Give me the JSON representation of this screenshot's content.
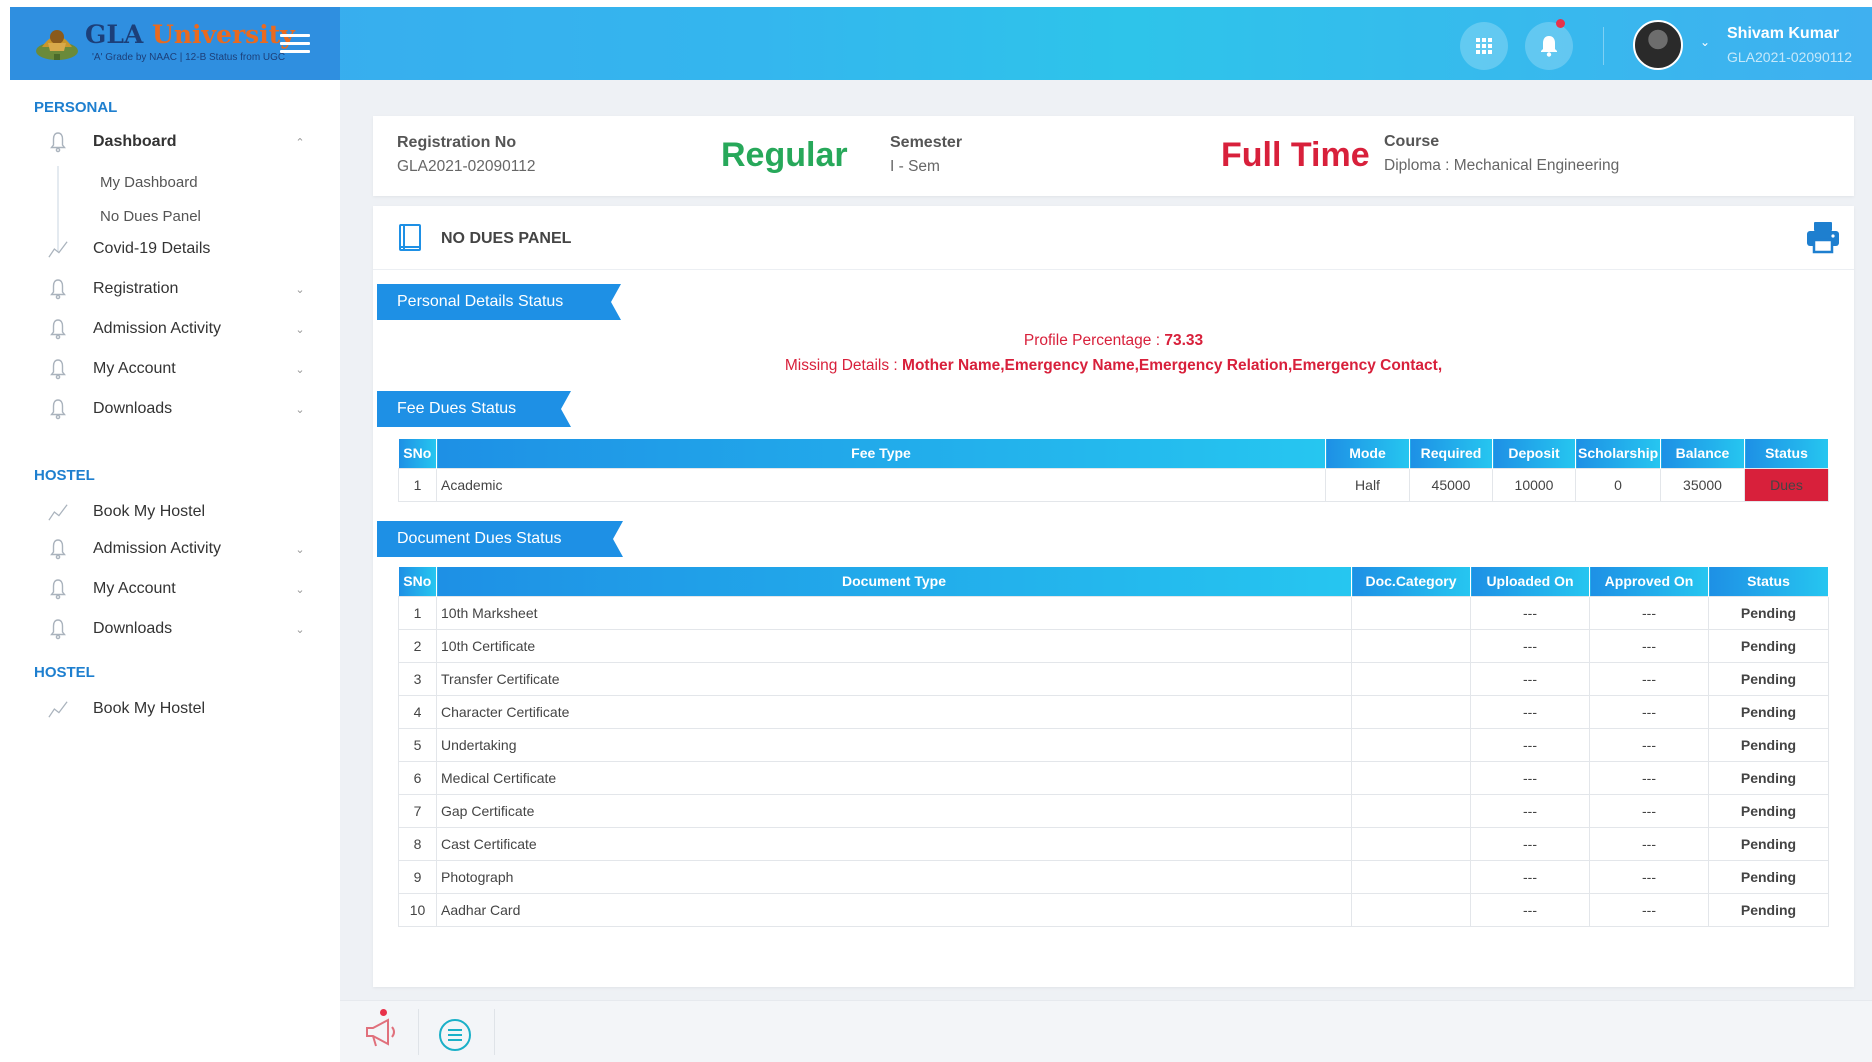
{
  "header": {
    "logo": {
      "name_part1": "GLA",
      "name_part2": "University",
      "tagline": "'A' Grade by NAAC | 12-B Status from UGC"
    },
    "user": {
      "name": "Shivam Kumar",
      "id": "GLA2021-02090112"
    }
  },
  "sidebar": {
    "sections": [
      {
        "title": "PERSONAL"
      },
      {
        "title": "HOSTEL"
      },
      {
        "title": "HOSTEL"
      }
    ],
    "items": [
      {
        "label": "Dashboard",
        "icon": "bell-icon"
      },
      {
        "label": "Covid-19 Details",
        "icon": "chart-line-icon"
      },
      {
        "label": "Registration",
        "icon": "bell-icon"
      },
      {
        "label": "Admission Activity",
        "icon": "bell-icon"
      },
      {
        "label": "My Account",
        "icon": "bell-icon"
      },
      {
        "label": "Downloads",
        "icon": "bell-icon"
      },
      {
        "label": "Book My Hostel",
        "icon": "chart-line-icon"
      },
      {
        "label": "Admission Activity",
        "icon": "bell-icon"
      },
      {
        "label": "My Account",
        "icon": "bell-icon"
      },
      {
        "label": "Downloads",
        "icon": "bell-icon"
      },
      {
        "label": "Book My Hostel",
        "icon": "chart-line-icon"
      }
    ],
    "dashboard_sub": [
      "My Dashboard",
      "No Dues Panel"
    ]
  },
  "info": {
    "reg_label": "Registration No",
    "reg_value": "GLA2021-02090112",
    "type": "Regular",
    "semester_label": "Semester",
    "semester_value": "I - Sem",
    "mode": "Full Time",
    "course_label": "Course",
    "course_value": "Diploma : Mechanical Engineering"
  },
  "panel": {
    "title": "NO DUES PANEL",
    "personal_section": "Personal Details Status",
    "profile_label": "Profile Percentage : ",
    "profile_value": "73.33",
    "missing_label": "Missing Details : ",
    "missing_value": "Mother Name,Emergency Name,Emergency Relation,Emergency Contact,",
    "fee_section": "Fee Dues Status",
    "doc_section": "Document Dues Status"
  },
  "fee_table": {
    "headers": [
      "SNo",
      "Fee Type",
      "Mode",
      "Required",
      "Deposit",
      "Scholarship",
      "Balance",
      "Status"
    ],
    "rows": [
      {
        "sno": "1",
        "type": "Academic",
        "mode": "Half",
        "required": "45000",
        "deposit": "10000",
        "scholarship": "0",
        "balance": "35000",
        "status": "Dues"
      }
    ]
  },
  "doc_table": {
    "headers": [
      "SNo",
      "Document Type",
      "Doc.Category",
      "Uploaded On",
      "Approved On",
      "Status"
    ],
    "rows": [
      {
        "sno": "1",
        "type": "10th Marksheet",
        "category": "",
        "uploaded": "---",
        "approved": "---",
        "status": "Pending"
      },
      {
        "sno": "2",
        "type": "10th Certificate",
        "category": "",
        "uploaded": "---",
        "approved": "---",
        "status": "Pending"
      },
      {
        "sno": "3",
        "type": "Transfer Certificate",
        "category": "",
        "uploaded": "---",
        "approved": "---",
        "status": "Pending"
      },
      {
        "sno": "4",
        "type": "Character Certificate",
        "category": "",
        "uploaded": "---",
        "approved": "---",
        "status": "Pending"
      },
      {
        "sno": "5",
        "type": "Undertaking",
        "category": "",
        "uploaded": "---",
        "approved": "---",
        "status": "Pending"
      },
      {
        "sno": "6",
        "type": "Medical Certificate",
        "category": "",
        "uploaded": "---",
        "approved": "---",
        "status": "Pending"
      },
      {
        "sno": "7",
        "type": "Gap Certificate",
        "category": "",
        "uploaded": "---",
        "approved": "---",
        "status": "Pending"
      },
      {
        "sno": "8",
        "type": "Cast Certificate",
        "category": "",
        "uploaded": "---",
        "approved": "---",
        "status": "Pending"
      },
      {
        "sno": "9",
        "type": "Photograph",
        "category": "",
        "uploaded": "---",
        "approved": "---",
        "status": "Pending"
      },
      {
        "sno": "10",
        "type": "Aadhar Card",
        "category": "",
        "uploaded": "---",
        "approved": "---",
        "status": "Pending"
      }
    ]
  },
  "colors": {
    "accent": "#1e90e5",
    "success": "#27a85a",
    "danger": "#d8203b",
    "link": "#1e7fcf"
  }
}
